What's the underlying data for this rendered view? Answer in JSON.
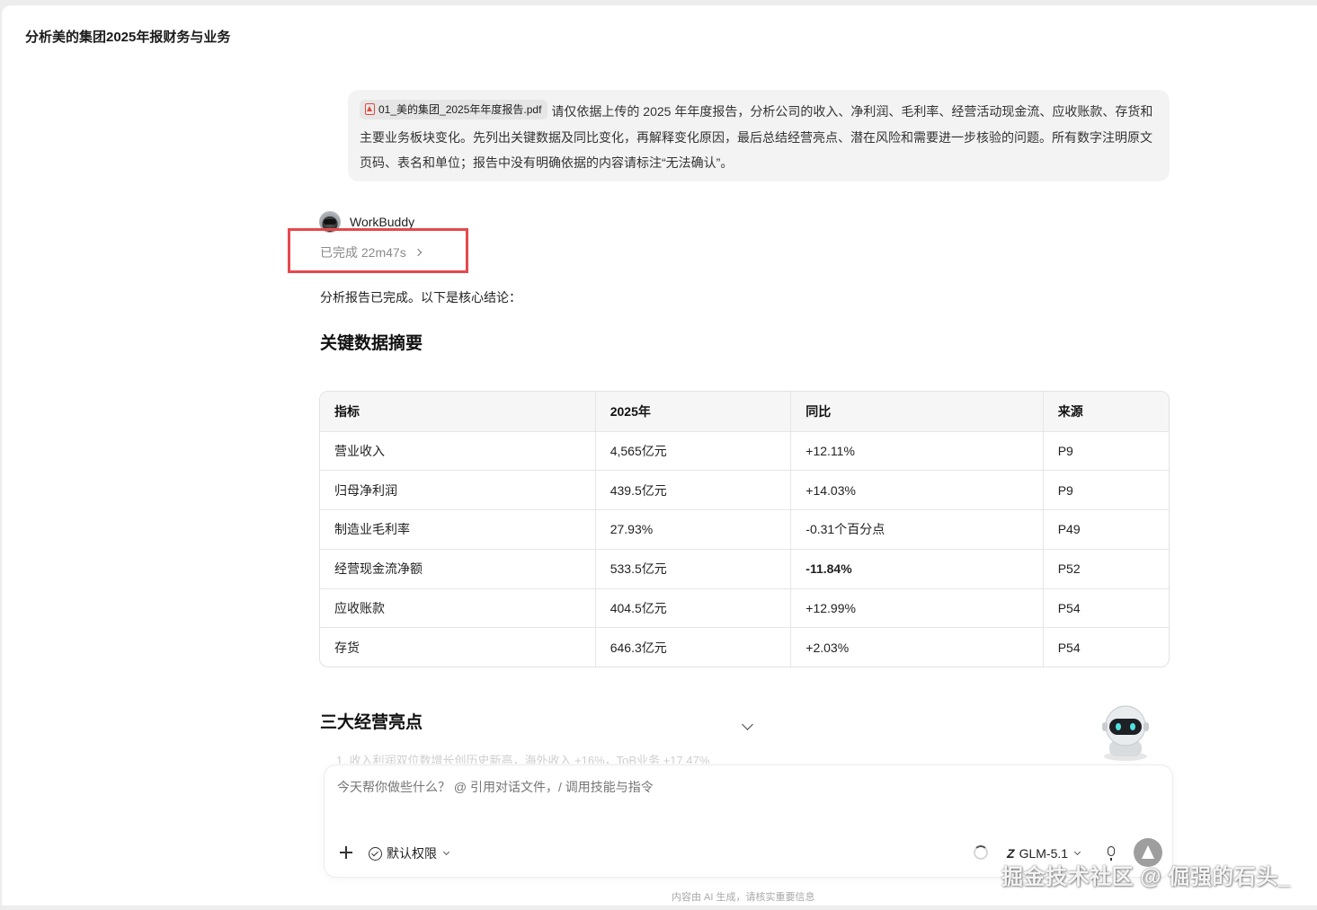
{
  "window": {
    "title": "分析美的集团2025年报财务与业务"
  },
  "user_message": {
    "attachment_name": "01_美的集团_2025年年度报告.pdf",
    "attachment_icon": "pdf-icon",
    "text": "请仅依据上传的 2025 年年度报告，分析公司的收入、净利润、毛利率、经营活动现金流、应收账款、存货和主要业务板块变化。先列出关键数据及同比变化，再解释变化原因，最后总结经营亮点、潜在风险和需要进一步核验的问题。所有数字注明原文页码、表名和单位；报告中没有明确依据的内容请标注“无法确认”。"
  },
  "assistant": {
    "name": "WorkBuddy",
    "status": "已完成 22m47s",
    "intro": "分析报告已完成。以下是核心结论：",
    "section1_title": "关键数据摘要",
    "table": {
      "headers": [
        "指标",
        "2025年",
        "同比",
        "来源"
      ],
      "rows": [
        [
          "营业收入",
          "4,565亿元",
          "+12.11%",
          "P9"
        ],
        [
          "归母净利润",
          "439.5亿元",
          "+14.03%",
          "P9"
        ],
        [
          "制造业毛利率",
          "27.93%",
          "-0.31个百分点",
          "P49"
        ],
        [
          "经营现金流净额",
          "533.5亿元",
          "-11.84%",
          "P52"
        ],
        [
          "应收账款",
          "404.5亿元",
          "+12.99%",
          "P54"
        ],
        [
          "存货",
          "646.3亿元",
          "+2.03%",
          "P54"
        ]
      ]
    },
    "section2_title": "三大经营亮点",
    "section2_first_line": "1. 收入利润双位数增长创历史新高，海外收入 +16%，ToB业务 +17.47%"
  },
  "composer": {
    "placeholder": "今天帮你做些什么？ @ 引用对话文件，/ 调用技能与指令",
    "permission_label": "默认权限",
    "model_label": "GLM-5.1",
    "disclaimer": "内容由 AI 生成，请核实重要信息"
  },
  "watermark": "掘金技术社区 @ 倔强的石头_",
  "colors": {
    "highlight_box": "#e5484d",
    "pdf_icon": "#e04a3f",
    "send_button": "#9e9e9e"
  }
}
